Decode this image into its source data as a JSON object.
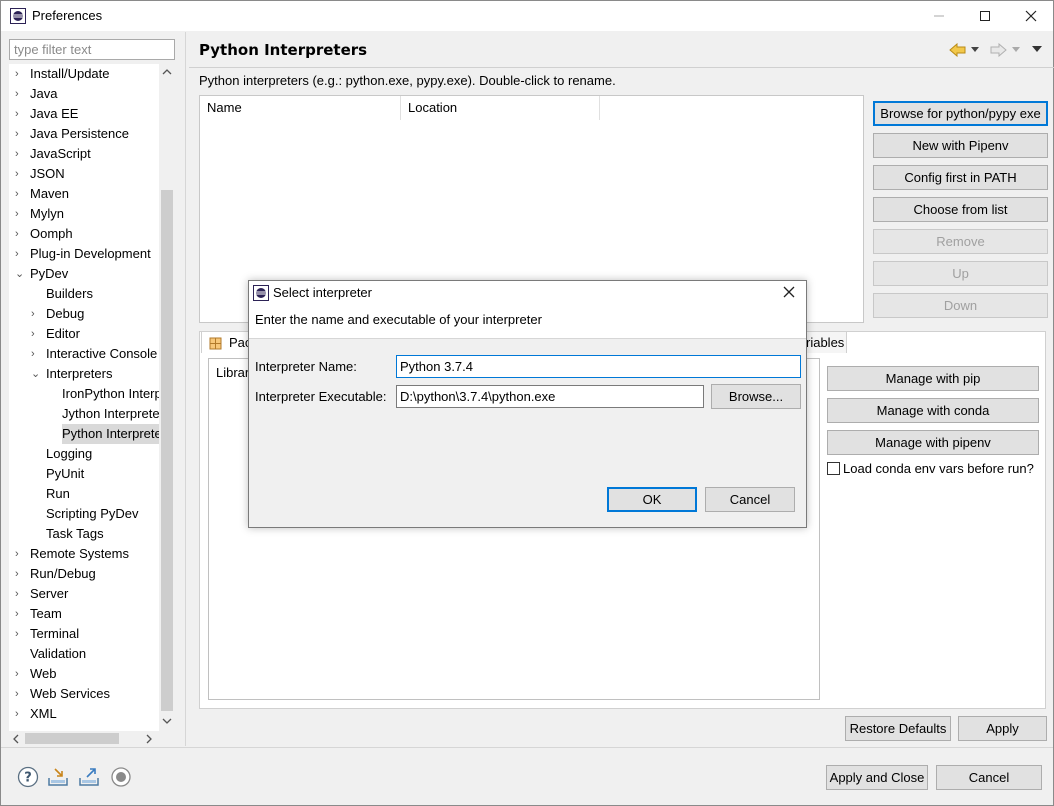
{
  "window": {
    "title": "Preferences"
  },
  "filter": {
    "placeholder": "type filter text"
  },
  "tree": [
    {
      "label": "Install/Update",
      "level": 0,
      "arrow": "›"
    },
    {
      "label": "Java",
      "level": 0,
      "arrow": "›"
    },
    {
      "label": "Java EE",
      "level": 0,
      "arrow": "›"
    },
    {
      "label": "Java Persistence",
      "level": 0,
      "arrow": "›"
    },
    {
      "label": "JavaScript",
      "level": 0,
      "arrow": "›"
    },
    {
      "label": "JSON",
      "level": 0,
      "arrow": "›"
    },
    {
      "label": "Maven",
      "level": 0,
      "arrow": "›"
    },
    {
      "label": "Mylyn",
      "level": 0,
      "arrow": "›"
    },
    {
      "label": "Oomph",
      "level": 0,
      "arrow": "›"
    },
    {
      "label": "Plug-in Development",
      "level": 0,
      "arrow": "›"
    },
    {
      "label": "PyDev",
      "level": 0,
      "arrow": "⌄"
    },
    {
      "label": "Builders",
      "level": 1,
      "arrow": ""
    },
    {
      "label": "Debug",
      "level": 1,
      "arrow": "›"
    },
    {
      "label": "Editor",
      "level": 1,
      "arrow": "›"
    },
    {
      "label": "Interactive Console",
      "level": 1,
      "arrow": "›"
    },
    {
      "label": "Interpreters",
      "level": 1,
      "arrow": "⌄"
    },
    {
      "label": "IronPython Interp",
      "level": 2,
      "arrow": ""
    },
    {
      "label": "Jython Interprete",
      "level": 2,
      "arrow": ""
    },
    {
      "label": "Python Interprete",
      "level": 2,
      "arrow": "",
      "selected": true
    },
    {
      "label": "Logging",
      "level": 1,
      "arrow": ""
    },
    {
      "label": "PyUnit",
      "level": 1,
      "arrow": ""
    },
    {
      "label": "Run",
      "level": 1,
      "arrow": ""
    },
    {
      "label": "Scripting PyDev",
      "level": 1,
      "arrow": ""
    },
    {
      "label": "Task Tags",
      "level": 1,
      "arrow": ""
    },
    {
      "label": "Remote Systems",
      "level": 0,
      "arrow": "›"
    },
    {
      "label": "Run/Debug",
      "level": 0,
      "arrow": "›"
    },
    {
      "label": "Server",
      "level": 0,
      "arrow": "›"
    },
    {
      "label": "Team",
      "level": 0,
      "arrow": "›"
    },
    {
      "label": "Terminal",
      "level": 0,
      "arrow": "›"
    },
    {
      "label": "Validation",
      "level": 0,
      "arrow": ""
    },
    {
      "label": "Web",
      "level": 0,
      "arrow": "›"
    },
    {
      "label": "Web Services",
      "level": 0,
      "arrow": "›"
    },
    {
      "label": "XML",
      "level": 0,
      "arrow": "›"
    }
  ],
  "page": {
    "title": "Python Interpreters",
    "description": "Python interpreters (e.g.: python.exe, pypy.exe).   Double-click to rename.",
    "columns": [
      "Name",
      "Location"
    ],
    "buttons": {
      "browse": "Browse for python/pypy exe",
      "pipenv": "New with Pipenv",
      "config_path": "Config first in PATH",
      "choose": "Choose from list",
      "remove": "Remove",
      "up": "Up",
      "down": "Down"
    },
    "tab_packages": "Pac",
    "tab_variables": "riables",
    "libraries_label": "Librar",
    "manage": {
      "pip": "Manage with pip",
      "conda": "Manage with conda",
      "pipenv": "Manage with pipenv"
    },
    "conda_checkbox": "Load conda env vars before run?",
    "restore_defaults": "Restore Defaults",
    "apply": "Apply"
  },
  "footer": {
    "apply_close": "Apply and Close",
    "cancel": "Cancel"
  },
  "dialog": {
    "title": "Select interpreter",
    "message": "Enter the name and executable of your interpreter",
    "name_label": "Interpreter Name:",
    "name_value": "Python 3.7.4",
    "exe_label": "Interpreter Executable:",
    "exe_value": "D:\\python\\3.7.4\\python.exe",
    "browse": "Browse...",
    "ok": "OK",
    "cancel": "Cancel"
  },
  "colors": {
    "accent": "#0078d7",
    "selected": "#d9d9d9"
  }
}
